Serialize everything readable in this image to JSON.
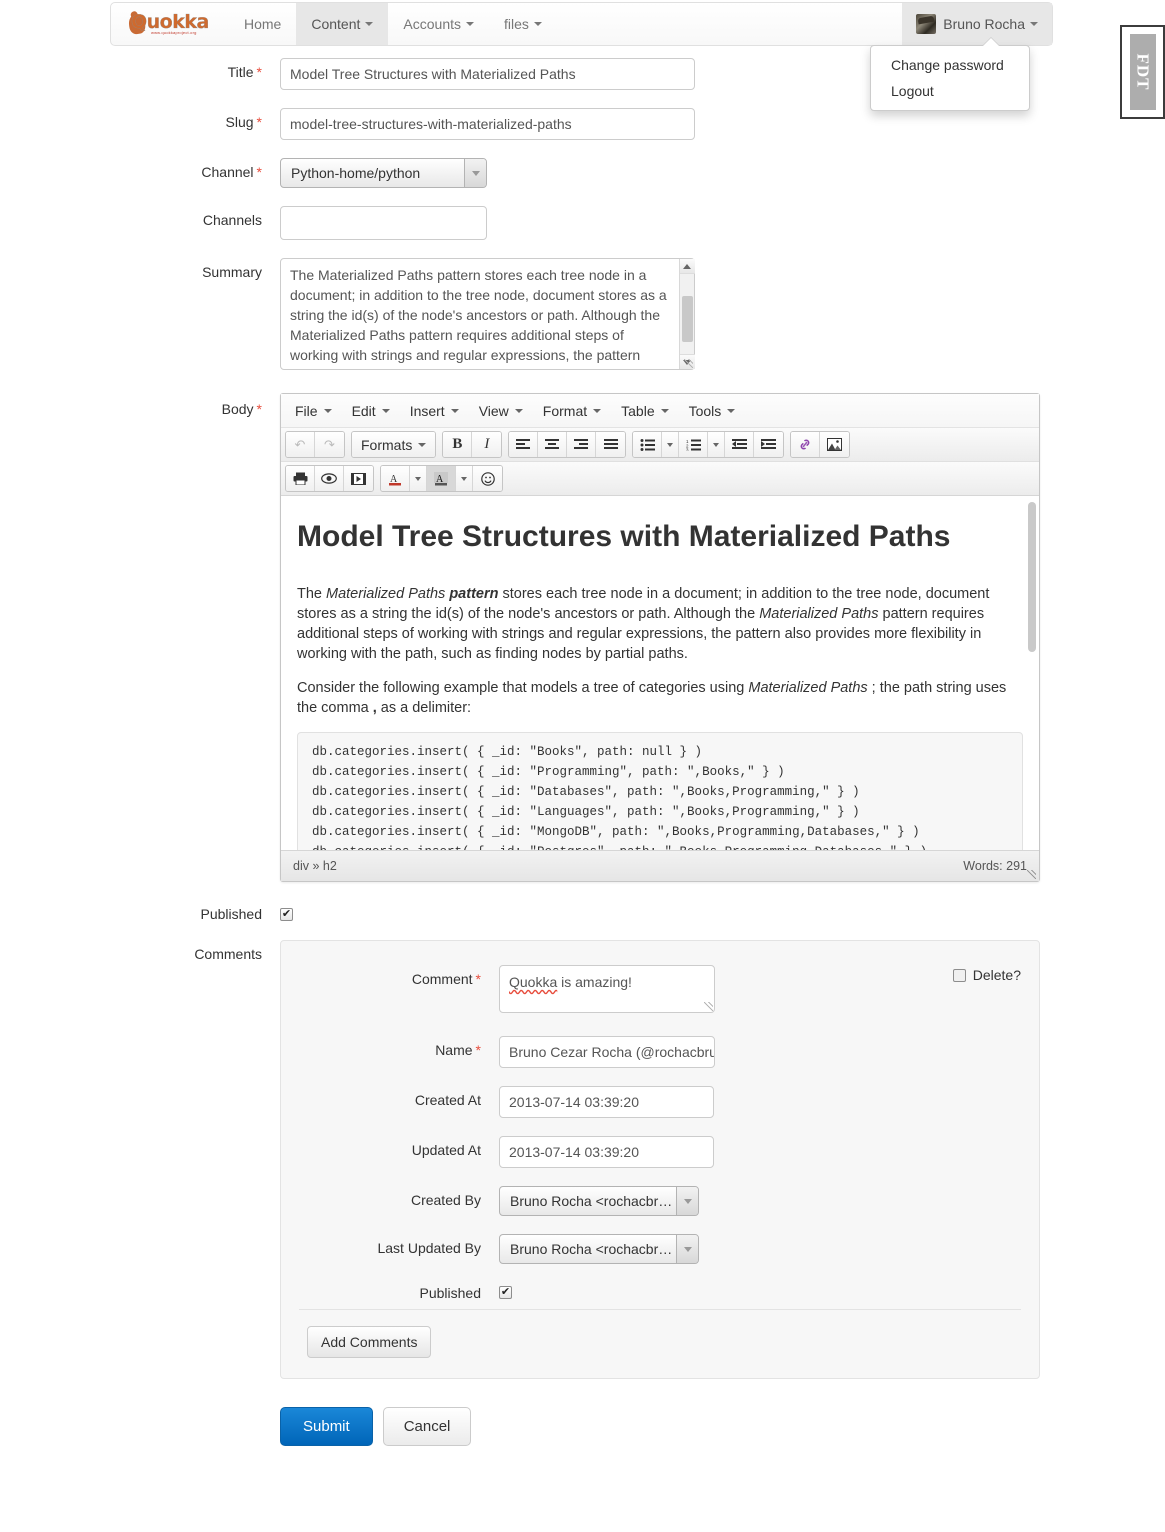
{
  "navbar": {
    "brand": "Quokka",
    "brand_sub": "www.quokkaproject.org",
    "items": [
      {
        "label": "Home",
        "caret": false,
        "active": false
      },
      {
        "label": "Content",
        "caret": true,
        "active": true
      },
      {
        "label": "Accounts",
        "caret": true,
        "active": false
      },
      {
        "label": "files",
        "caret": true,
        "active": false
      }
    ],
    "user": {
      "name": "Bruno Rocha",
      "avatar_icon": "user-avatar",
      "menu": [
        "Change password",
        "Logout"
      ]
    }
  },
  "side_tab": {
    "label": "FDT"
  },
  "form": {
    "title": {
      "label": "Title",
      "required": true,
      "value": "Model Tree Structures with Materialized Paths"
    },
    "slug": {
      "label": "Slug",
      "required": true,
      "value": "model-tree-structures-with-materialized-paths"
    },
    "channel": {
      "label": "Channel",
      "required": true,
      "value": "Python-home/python"
    },
    "channels": {
      "label": "Channels",
      "required": false,
      "value": "",
      "placeholder": ""
    },
    "summary": {
      "label": "Summary",
      "value": "The Materialized Paths pattern stores each tree node in a document; in addition to the tree node, document stores as a string the id(s) of the node's ancestors or path. Although the Materialized Paths pattern requires additional steps of working with strings and regular expressions, the pattern"
    },
    "body": {
      "label": "Body",
      "required": true
    },
    "published": {
      "label": "Published",
      "checked": true,
      "check_glyph": "✔"
    },
    "comments_label": "Comments"
  },
  "editor": {
    "menubar": [
      "File",
      "Edit",
      "Insert",
      "View",
      "Format",
      "Table",
      "Tools"
    ],
    "toolbar_row2": [
      {
        "name": "undo-icon",
        "glyph": "↰",
        "disabled": true
      },
      {
        "name": "redo-icon",
        "glyph": "↱",
        "disabled": true
      },
      {
        "name": "formats-dropdown",
        "glyph": "Formats",
        "wide": true
      },
      {
        "name": "bold-icon",
        "glyph": "B"
      },
      {
        "name": "italic-icon",
        "glyph": "I"
      },
      {
        "name": "align-left-icon",
        "glyph": "≡"
      },
      {
        "name": "align-center-icon",
        "glyph": "≡"
      },
      {
        "name": "align-right-icon",
        "glyph": "≡"
      },
      {
        "name": "align-justify-icon",
        "glyph": "≡"
      },
      {
        "name": "bullet-list-icon",
        "glyph": "☰"
      },
      {
        "name": "numbered-list-icon",
        "glyph": "☰"
      },
      {
        "name": "outdent-icon",
        "glyph": "⇤"
      },
      {
        "name": "indent-icon",
        "glyph": "⇥"
      },
      {
        "name": "link-icon",
        "glyph": "🔗"
      },
      {
        "name": "image-icon",
        "glyph": "🖼"
      }
    ],
    "toolbar_row3": [
      {
        "name": "print-icon",
        "glyph": "⎙"
      },
      {
        "name": "preview-icon",
        "glyph": "👁"
      },
      {
        "name": "media-icon",
        "glyph": "▣"
      },
      {
        "name": "text-color-icon",
        "glyph": "A"
      },
      {
        "name": "background-color-icon",
        "glyph": "A"
      },
      {
        "name": "emoticon-icon",
        "glyph": "☺"
      }
    ],
    "formats_label": "Formats",
    "content": {
      "heading": "Model Tree Structures with Materialized Paths",
      "p1_a": "The ",
      "p1_em1": "Materialized Paths",
      "p1_b": " ",
      "p1_bold": "pattern",
      "p1_c": " stores each tree node in a document; in addition to the tree node, document stores as a string the id(s) of the node's ancestors or path. Although the ",
      "p1_em2": "Materialized Paths",
      "p1_d": " pattern requires additional steps of working with strings and regular expressions, the pattern also provides more flexibility in working with the path, such as finding nodes by partial paths.",
      "p2_a": "Consider the following example that models a tree of categories using ",
      "p2_em": "Materialized Paths",
      "p2_b": " ; the path string uses the comma ",
      "p2_comma": ",",
      "p2_c": " as a delimiter:",
      "code": "db.categories.insert( { _id: \"Books\", path: null } )\ndb.categories.insert( { _id: \"Programming\", path: \",Books,\" } )\ndb.categories.insert( { _id: \"Databases\", path: \",Books,Programming,\" } )\ndb.categories.insert( { _id: \"Languages\", path: \",Books,Programming,\" } )\ndb.categories.insert( { _id: \"MongoDB\", path: \",Books,Programming,Databases,\" } )\ndb.categories.insert( { _id: \"Postgres\", path: \",Books,Programming,Databases,\" } )"
    },
    "status": {
      "path": "div » h2",
      "words": "Words: 291"
    }
  },
  "comment": {
    "delete_label": "Delete?",
    "delete_checked": false,
    "fields": {
      "comment": {
        "label": "Comment",
        "required": true,
        "value": "Quokka is amazing!",
        "spell_word": "Quokka",
        "rest": " is amazing!"
      },
      "name": {
        "label": "Name",
        "required": true,
        "value": "Bruno Cezar Rocha (@rochacbru"
      },
      "created_at": {
        "label": "Created At",
        "value": "2013-07-14 03:39:20"
      },
      "updated_at": {
        "label": "Updated At",
        "value": "2013-07-14 03:39:20"
      },
      "created_by": {
        "label": "Created By",
        "value": "Bruno Rocha <rochacbr…"
      },
      "last_updated_by": {
        "label": "Last Updated By",
        "value": "Bruno Rocha <rochacbr…"
      },
      "published": {
        "label": "Published",
        "checked": true,
        "check_glyph": "✔"
      }
    },
    "add_button": "Add Comments"
  },
  "footer": {
    "submit": "Submit",
    "cancel": "Cancel"
  },
  "colors": {
    "primary": "#0065b8",
    "required": "#e74c3c",
    "brand": "#cf6a2e",
    "spell": "#e74c3c"
  }
}
